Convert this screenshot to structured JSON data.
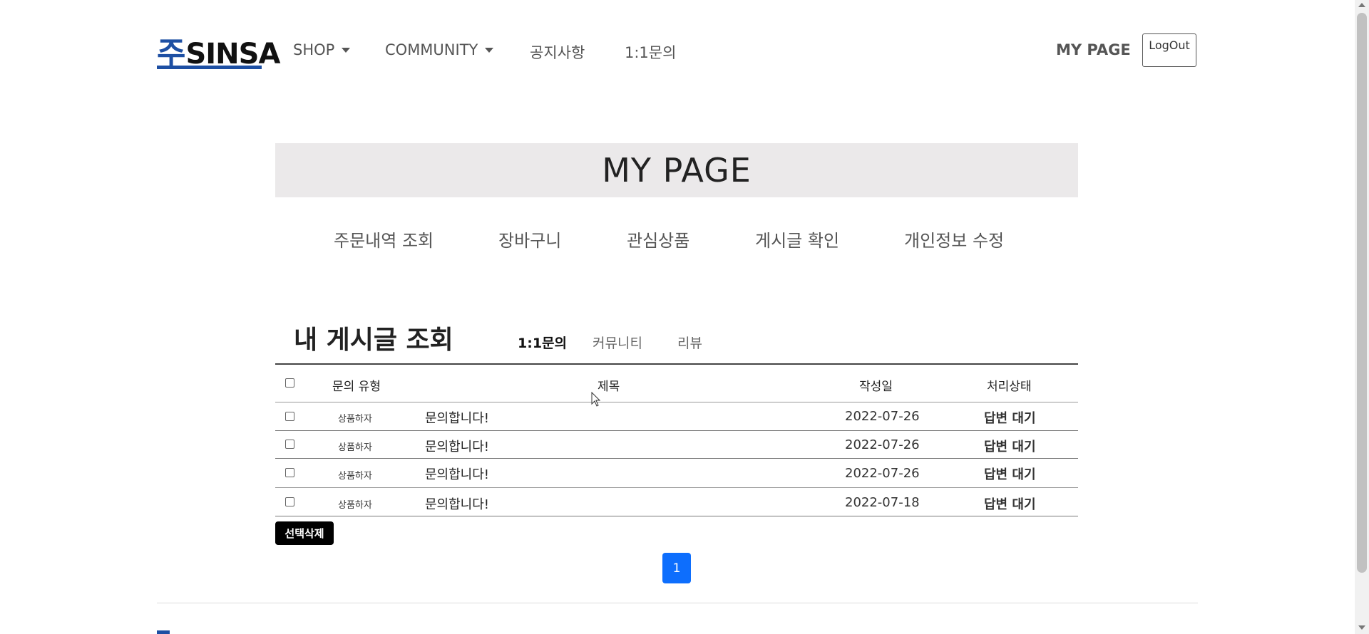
{
  "navbar": {
    "logo_mark": "주",
    "logo_text": "SINSA",
    "items": [
      {
        "label": "SHOP",
        "dropdown": true
      },
      {
        "label": "COMMUNITY",
        "dropdown": true
      },
      {
        "label": "공지사항",
        "dropdown": false
      },
      {
        "label": "1:1문의",
        "dropdown": false
      }
    ],
    "mypage_label": "MY PAGE",
    "logout_label": "LogOut"
  },
  "banner": {
    "title": "MY PAGE"
  },
  "mypage_menu": [
    "주문내역 조회",
    "장바구니",
    "관심상품",
    "게시글 확인",
    "개인정보 수정"
  ],
  "section": {
    "title": "내 게시글 조회",
    "tabs": [
      {
        "label": "1:1문의",
        "active": true
      },
      {
        "label": "커뮤니티",
        "active": false
      },
      {
        "label": "리뷰",
        "active": false
      }
    ]
  },
  "table": {
    "headers": {
      "type": "문의 유형",
      "title": "제목",
      "date": "작성일",
      "status": "처리상태"
    },
    "rows": [
      {
        "type": "상품하자",
        "title": "문의합니다!",
        "date": "2022-07-26",
        "status": "답변 대기"
      },
      {
        "type": "상품하자",
        "title": "문의합니다!",
        "date": "2022-07-26",
        "status": "답변 대기"
      },
      {
        "type": "상품하자",
        "title": "문의합니다!",
        "date": "2022-07-26",
        "status": "답변 대기"
      },
      {
        "type": "상품하자",
        "title": "문의합니다!",
        "date": "2022-07-18",
        "status": "답변 대기"
      }
    ]
  },
  "delete_button": "선택삭제",
  "pagination": {
    "current": "1"
  },
  "colors": {
    "brand": "#1d4fa3",
    "page_active": "#0d6efd",
    "banner_bg": "#ebe9ea"
  }
}
